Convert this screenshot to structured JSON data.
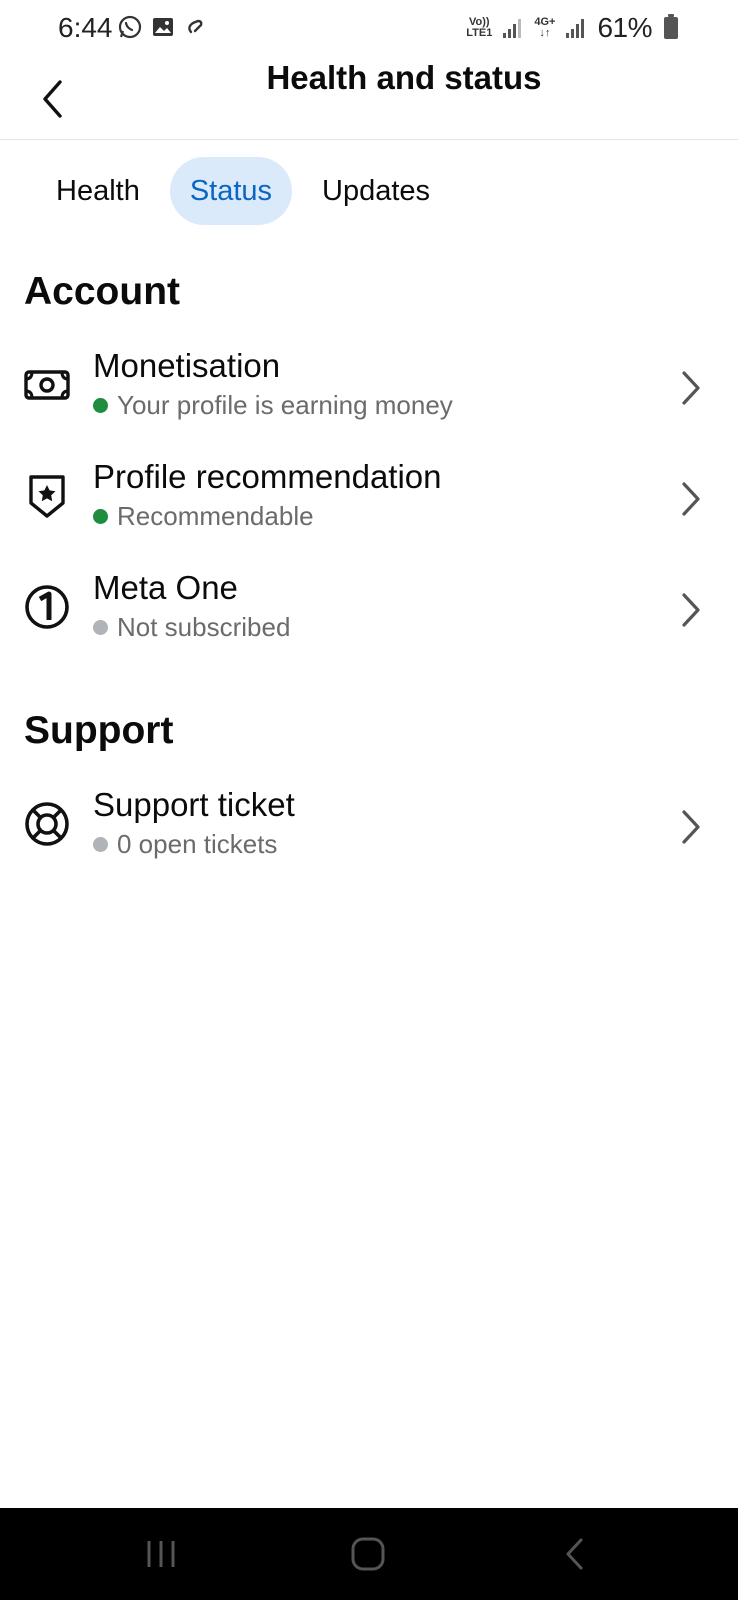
{
  "status_bar": {
    "time": "6:44",
    "left_icons": [
      "whatsapp-icon",
      "gallery-icon",
      "link-icon"
    ],
    "network1_label_top": "Vo))",
    "network1_label_bottom": "LTE1",
    "network2_label_top": "4G+",
    "battery_percent": "61%"
  },
  "header": {
    "title": "Health and status"
  },
  "tabs": [
    {
      "label": "Health",
      "active": false
    },
    {
      "label": "Status",
      "active": true
    },
    {
      "label": "Updates",
      "active": false
    }
  ],
  "account": {
    "heading": "Account",
    "items": [
      {
        "title": "Monetisation",
        "subtitle": "Your profile is earning money",
        "status_color": "#1e8e3e",
        "icon": "money-icon"
      },
      {
        "title": "Profile recommendation",
        "subtitle": "Recommendable",
        "status_color": "#1e8e3e",
        "icon": "shield-star-icon"
      },
      {
        "title": "Meta One",
        "subtitle": "Not subscribed",
        "status_color": "#b0b3b8",
        "icon": "meta-one-icon"
      }
    ]
  },
  "support": {
    "heading": "Support",
    "items": [
      {
        "title": "Support ticket",
        "subtitle": "0 open tickets",
        "status_color": "#b0b3b8",
        "icon": "lifebuoy-icon"
      }
    ]
  },
  "colors": {
    "accent": "#0a66c2",
    "active_tab_bg": "#dbeafb",
    "green_status": "#1e8e3e",
    "grey_status": "#b0b3b8"
  }
}
